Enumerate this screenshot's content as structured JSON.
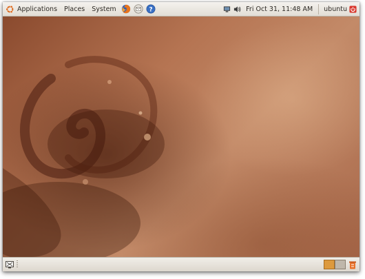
{
  "top_panel": {
    "menus": {
      "applications": "Applications",
      "places": "Places",
      "system": "System"
    },
    "launchers": [
      "firefox-icon",
      "mail-icon",
      "help-icon"
    ],
    "tray": [
      "network-icon",
      "volume-icon"
    ],
    "clock": "Fri Oct 31, 11:48 AM",
    "user": "ubuntu"
  },
  "bottom_panel": {
    "workspaces": [
      {
        "name": "workspace-1",
        "active": true
      },
      {
        "name": "workspace-2",
        "active": false
      }
    ]
  },
  "colors": {
    "accent": "#dd6a1f",
    "workspace_active": "#dd9a3e",
    "wallpaper": "#b57452"
  }
}
